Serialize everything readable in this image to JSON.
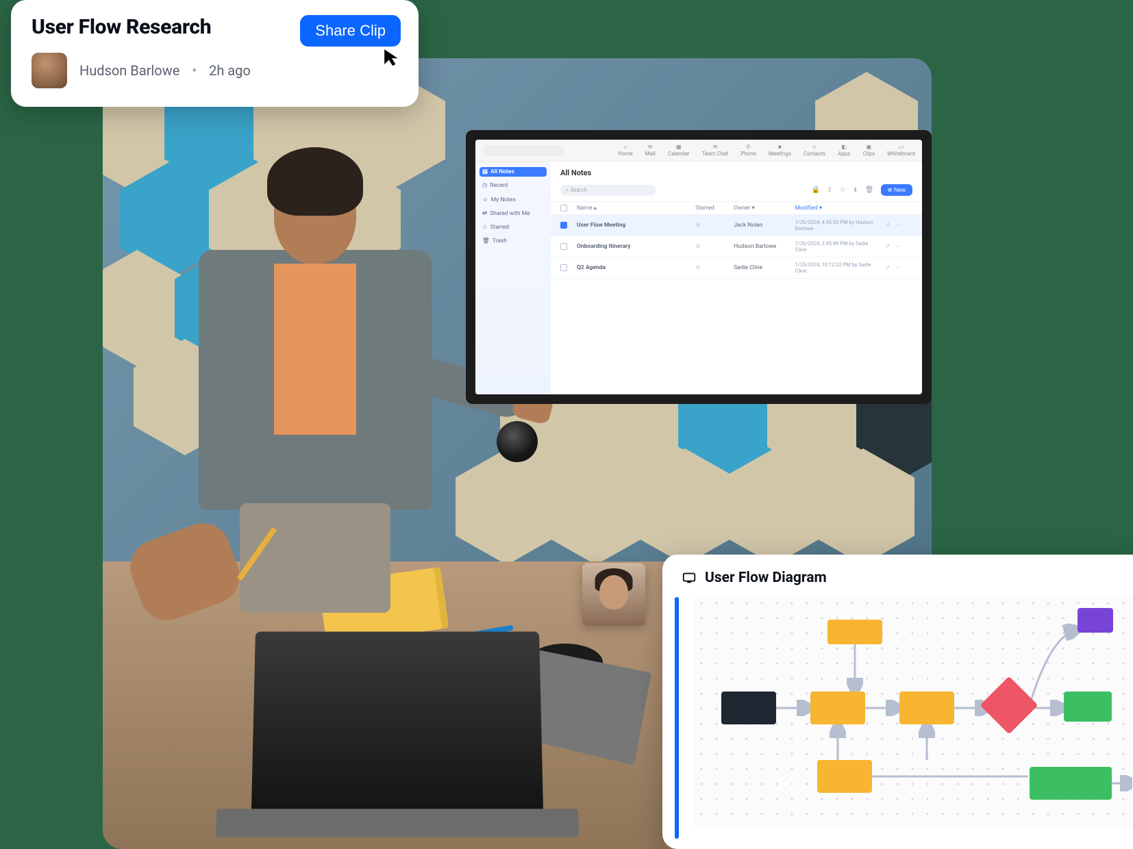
{
  "clip": {
    "title": "User Flow Research",
    "author": "Hudson Barlowe",
    "time": "2h ago",
    "share_label": "Share Clip"
  },
  "wall_app": {
    "search_placeholder": "Search",
    "top_tabs": [
      "Home",
      "Mail",
      "Calendar",
      "Team Chat",
      "Phone",
      "Meetings",
      "Contacts",
      "Apps",
      "Clips",
      "Whiteboard"
    ],
    "sidebar": {
      "all_notes": "All Notes",
      "recent": "Recent",
      "my_notes": "My Notes",
      "shared": "Shared with Me",
      "starred": "Starred",
      "trash": "Trash"
    },
    "main": {
      "heading": "All Notes",
      "search_placeholder": "Search",
      "new_label": "New",
      "columns": {
        "name": "Name",
        "starred": "Starred",
        "owner": "Owner",
        "modified": "Modified"
      },
      "rows": [
        {
          "name": "User Flow Meeting",
          "owner": "Jack Nolan",
          "modified": "1/26/2024, 4:45:53 PM by Hudson Barlowe",
          "selected": true
        },
        {
          "name": "Onboarding Itinerary",
          "owner": "Hudson Barlowe",
          "modified": "1/26/2024, 2:45:49 PM by Sadie Cline",
          "selected": false
        },
        {
          "name": "Q2 Agenda",
          "owner": "Sadie Cline",
          "modified": "1/25/2024, 10:12:22 PM by Sadie Cline",
          "selected": false
        }
      ]
    }
  },
  "diagram": {
    "title": "User Flow Diagram"
  }
}
